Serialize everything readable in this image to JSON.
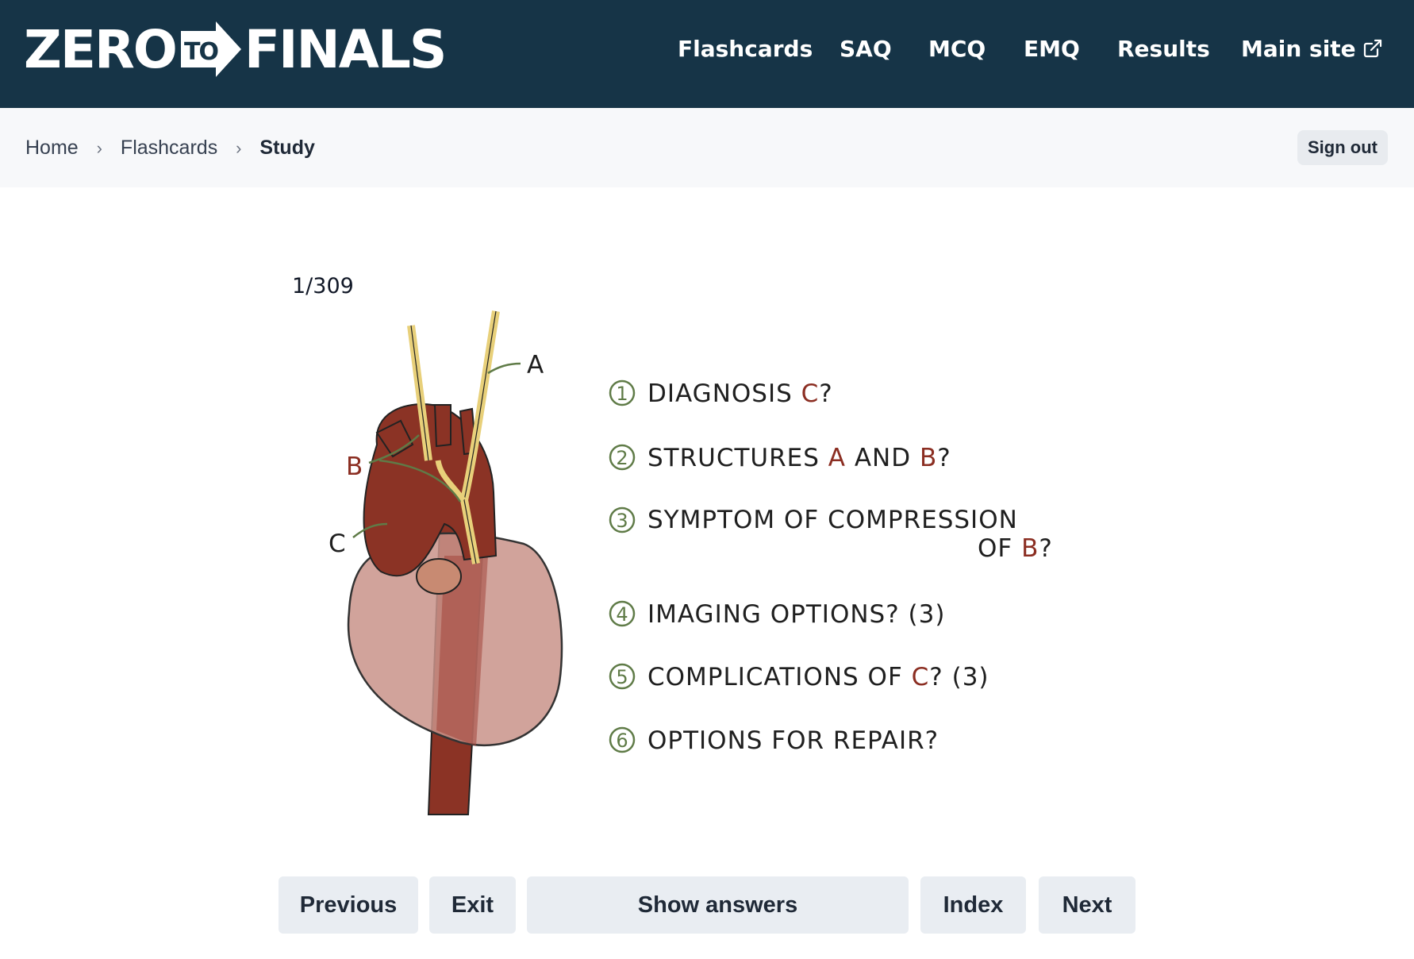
{
  "header": {
    "logo": {
      "left": "ZERO",
      "badge": "TO",
      "right": "FINALS"
    },
    "nav": [
      {
        "label": "Flashcards"
      },
      {
        "label": "SAQ"
      },
      {
        "label": "MCQ"
      },
      {
        "label": "EMQ"
      },
      {
        "label": "Results"
      },
      {
        "label": "Main site",
        "icon": "external-link-icon"
      }
    ]
  },
  "breadcrumb": {
    "items": [
      "Home",
      "Flashcards",
      "Study"
    ],
    "separator": "›"
  },
  "sign_out_label": "Sign out",
  "card": {
    "counter": "1/309",
    "labels": {
      "a": "A",
      "b": "B",
      "c": "C"
    },
    "questions": [
      {
        "num": "1",
        "parts": [
          "DIAGNOSIS ",
          "C",
          "?"
        ]
      },
      {
        "num": "2",
        "parts": [
          "STRUCTURES ",
          "A",
          " AND ",
          "B",
          "?"
        ]
      },
      {
        "num": "3",
        "parts": [
          "SYMPTOM OF COMPRESSION",
          "OF ",
          "B",
          "?"
        ]
      },
      {
        "num": "4",
        "parts": [
          "IMAGING OPTIONS? (3)"
        ]
      },
      {
        "num": "5",
        "parts": [
          "COMPLICATIONS OF ",
          "C",
          "? (3)"
        ]
      },
      {
        "num": "6",
        "parts": [
          "OPTIONS FOR REPAIR?"
        ]
      }
    ]
  },
  "buttons": {
    "previous": "Previous",
    "exit": "Exit",
    "show_answers": "Show answers",
    "index": "Index",
    "next": "Next"
  },
  "colors": {
    "header_bg": "#163447",
    "crumb_bg": "#f7f8fa",
    "button_bg": "#e9edf2",
    "aorta": "#8b3325",
    "nerve": "#e8d07a",
    "heart_shadow": "#c9938a",
    "question_number": "#5f7b47",
    "label_red": "#8b2e22"
  }
}
